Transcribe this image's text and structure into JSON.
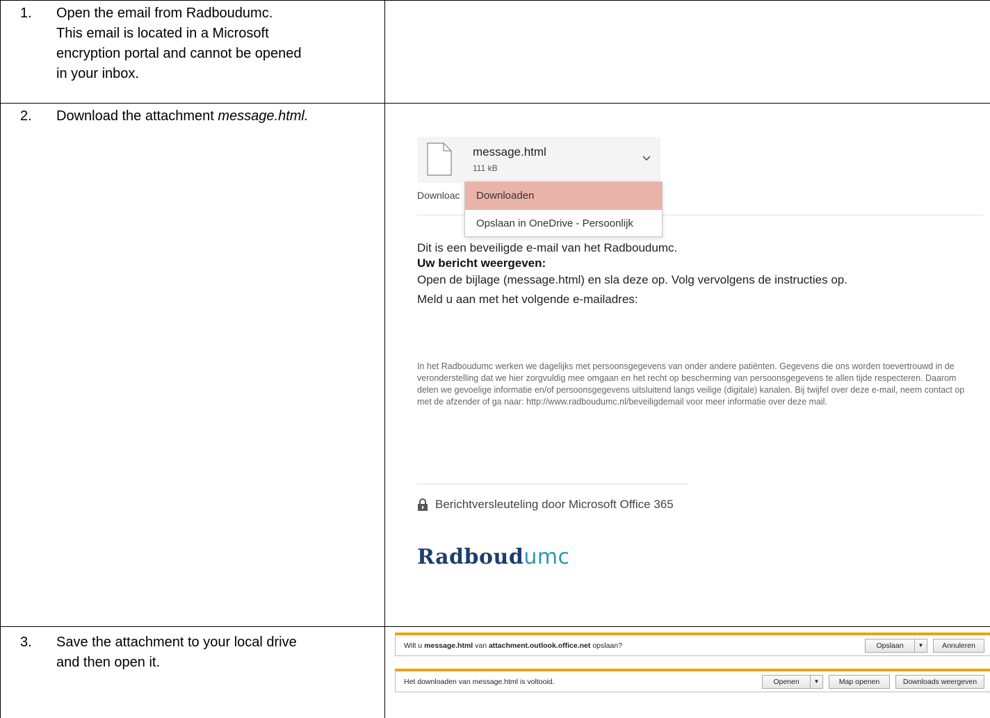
{
  "steps": [
    {
      "number": "1.",
      "lines": [
        "Open the email from Radboudumc.",
        "This email is located in a Microsoft",
        "encryption portal and cannot be opened",
        "in your inbox."
      ]
    },
    {
      "number": "2.",
      "text_prefix": "Download the attachment ",
      "text_em": "message.html."
    },
    {
      "number": "3.",
      "lines": [
        "Save the attachment to your local drive",
        "and then open it."
      ]
    }
  ],
  "email": {
    "attachment_name": "message.html",
    "attachment_size": "111 kB",
    "download_link": "Downloac",
    "menu": [
      "Downloaden",
      "Opslaan in OneDrive - Persoonlijk"
    ],
    "line1": "Dit is een beveiligde e-mail van het Radboudumc.",
    "line2": "Uw bericht weergeven:",
    "line3": "Open de bijlage (message.html) en sla deze op. Volg vervolgens de instructies op.",
    "line4": "Meld u aan met het volgende e-mailadres:",
    "disclaimer": "In het Radboudumc werken we dagelijks met persoonsgegevens van onder andere patiënten. Gegevens die ons worden toevertrouwd in de veronderstelling dat we hier zorgvuldig mee omgaan en het recht op bescherming van persoonsgegevens te allen tijde respecteren. Daarom delen we gevoelige informatie en/of persoonsgegevens uitsluitend langs veilige (digitale) kanalen. Bij twijfel over deze e-mail, neem contact op met de afzender of ga naar: http://www.radboudumc.nl/beveiligdemail voor meer informatie over deze mail.",
    "encryption_note": "Berichtversleuteling door Microsoft Office 365",
    "brand_part1": "Radboud",
    "brand_part2": "umc",
    "menu_highlight_color": "#eab3aa"
  },
  "browser_bars": {
    "save_prompt_prefix": "Wilt u ",
    "save_prompt_file": "message.html",
    "save_prompt_mid": " van ",
    "save_prompt_host": "attachment.outlook.office.net",
    "save_prompt_suffix": " opslaan?",
    "save_button": "Opslaan",
    "cancel_button": "Annuleren",
    "complete_text": "Het downloaden van message.html is voltooid.",
    "open_button": "Openen",
    "open_folder_button": "Map openen",
    "view_downloads_button": "Downloads weergeven",
    "accent_color": "#e8a317"
  }
}
